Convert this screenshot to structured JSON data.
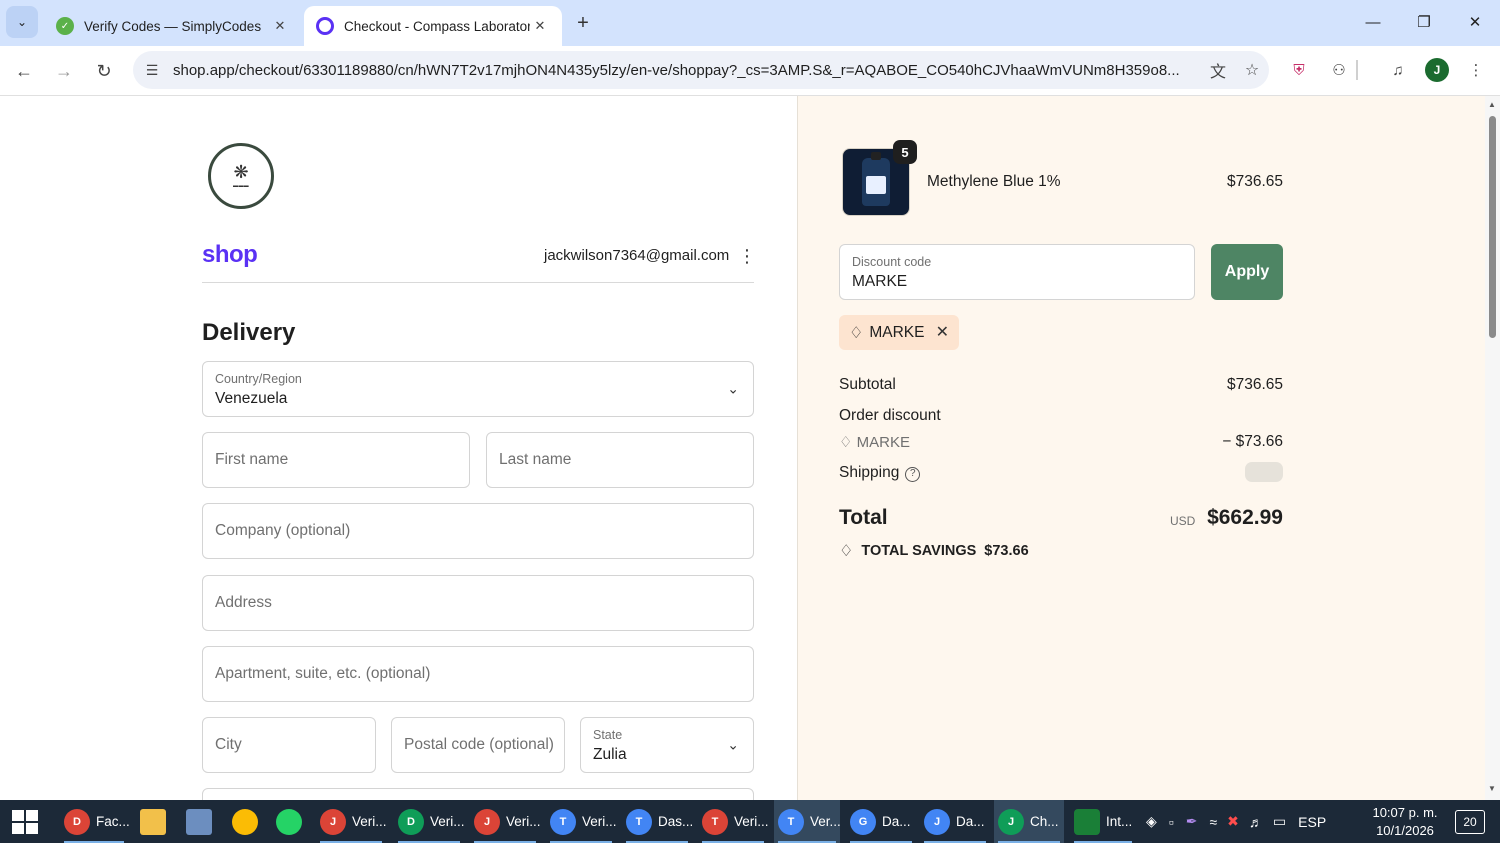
{
  "browser": {
    "tabs": [
      {
        "title": "Verify Codes — SimplyCodes",
        "active": false
      },
      {
        "title": "Checkout - Compass Laboratory",
        "active": true
      }
    ],
    "url": "shop.app/checkout/63301189880/cn/hWN7T2v17mjhON4N435y5lzy/en-ve/shoppay?_cs=3AMP.S&_r=AQABOE_CO540hCJVhaaWmVUNm8H359o8...",
    "avatar_initial": "J",
    "icons": {
      "tab_search": "chevron-down-icon",
      "back": "back-arrow-icon",
      "forward": "forward-arrow-icon",
      "reload": "reload-icon",
      "site_info": "site-info-icon",
      "translate": "translate-icon",
      "bookmark": "star-icon"
    }
  },
  "checkout": {
    "email": "jackwilson7364@gmail.com",
    "shop_brand": "shop",
    "section_title": "Delivery",
    "country": {
      "label": "Country/Region",
      "value": "Venezuela"
    },
    "fields": {
      "first_name": "First name",
      "last_name": "Last name",
      "company": "Company (optional)",
      "address": "Address",
      "apartment": "Apartment, suite, etc. (optional)",
      "city": "City",
      "postal_code": "Postal code (optional)"
    },
    "state": {
      "label": "State",
      "value": "Zulia"
    }
  },
  "summary": {
    "product": {
      "name": "Methylene Blue 1%",
      "price": "$736.65",
      "quantity": "5"
    },
    "discount_field": {
      "label": "Discount code",
      "value": "MARKE"
    },
    "apply_label": "Apply",
    "applied_code": "MARKE",
    "subtotal_label": "Subtotal",
    "subtotal": "$736.65",
    "order_discount_label": "Order discount",
    "discount_code": "MARKE",
    "discount_amount": "− $73.66",
    "shipping_label": "Shipping",
    "total_label": "Total",
    "currency": "USD",
    "total": "$662.99",
    "savings_label": "TOTAL SAVINGS",
    "savings_amount": "$73.66"
  },
  "colors": {
    "apply_button": "#4e8564",
    "summary_bg": "#fef7ee",
    "shop_brand": "#5a31f4",
    "tag_chip": "#fde4d0"
  },
  "taskbar": {
    "items": [
      "Fac...",
      "Veri...",
      "Veri...",
      "Veri...",
      "Veri...",
      "Das...",
      "Veri...",
      "Ver...",
      "Da...",
      "Da...",
      "Ch...",
      "Int..."
    ],
    "language": "ESP",
    "time": "10:07 p. m.",
    "date": "10/1/2026",
    "notifications": "20"
  }
}
